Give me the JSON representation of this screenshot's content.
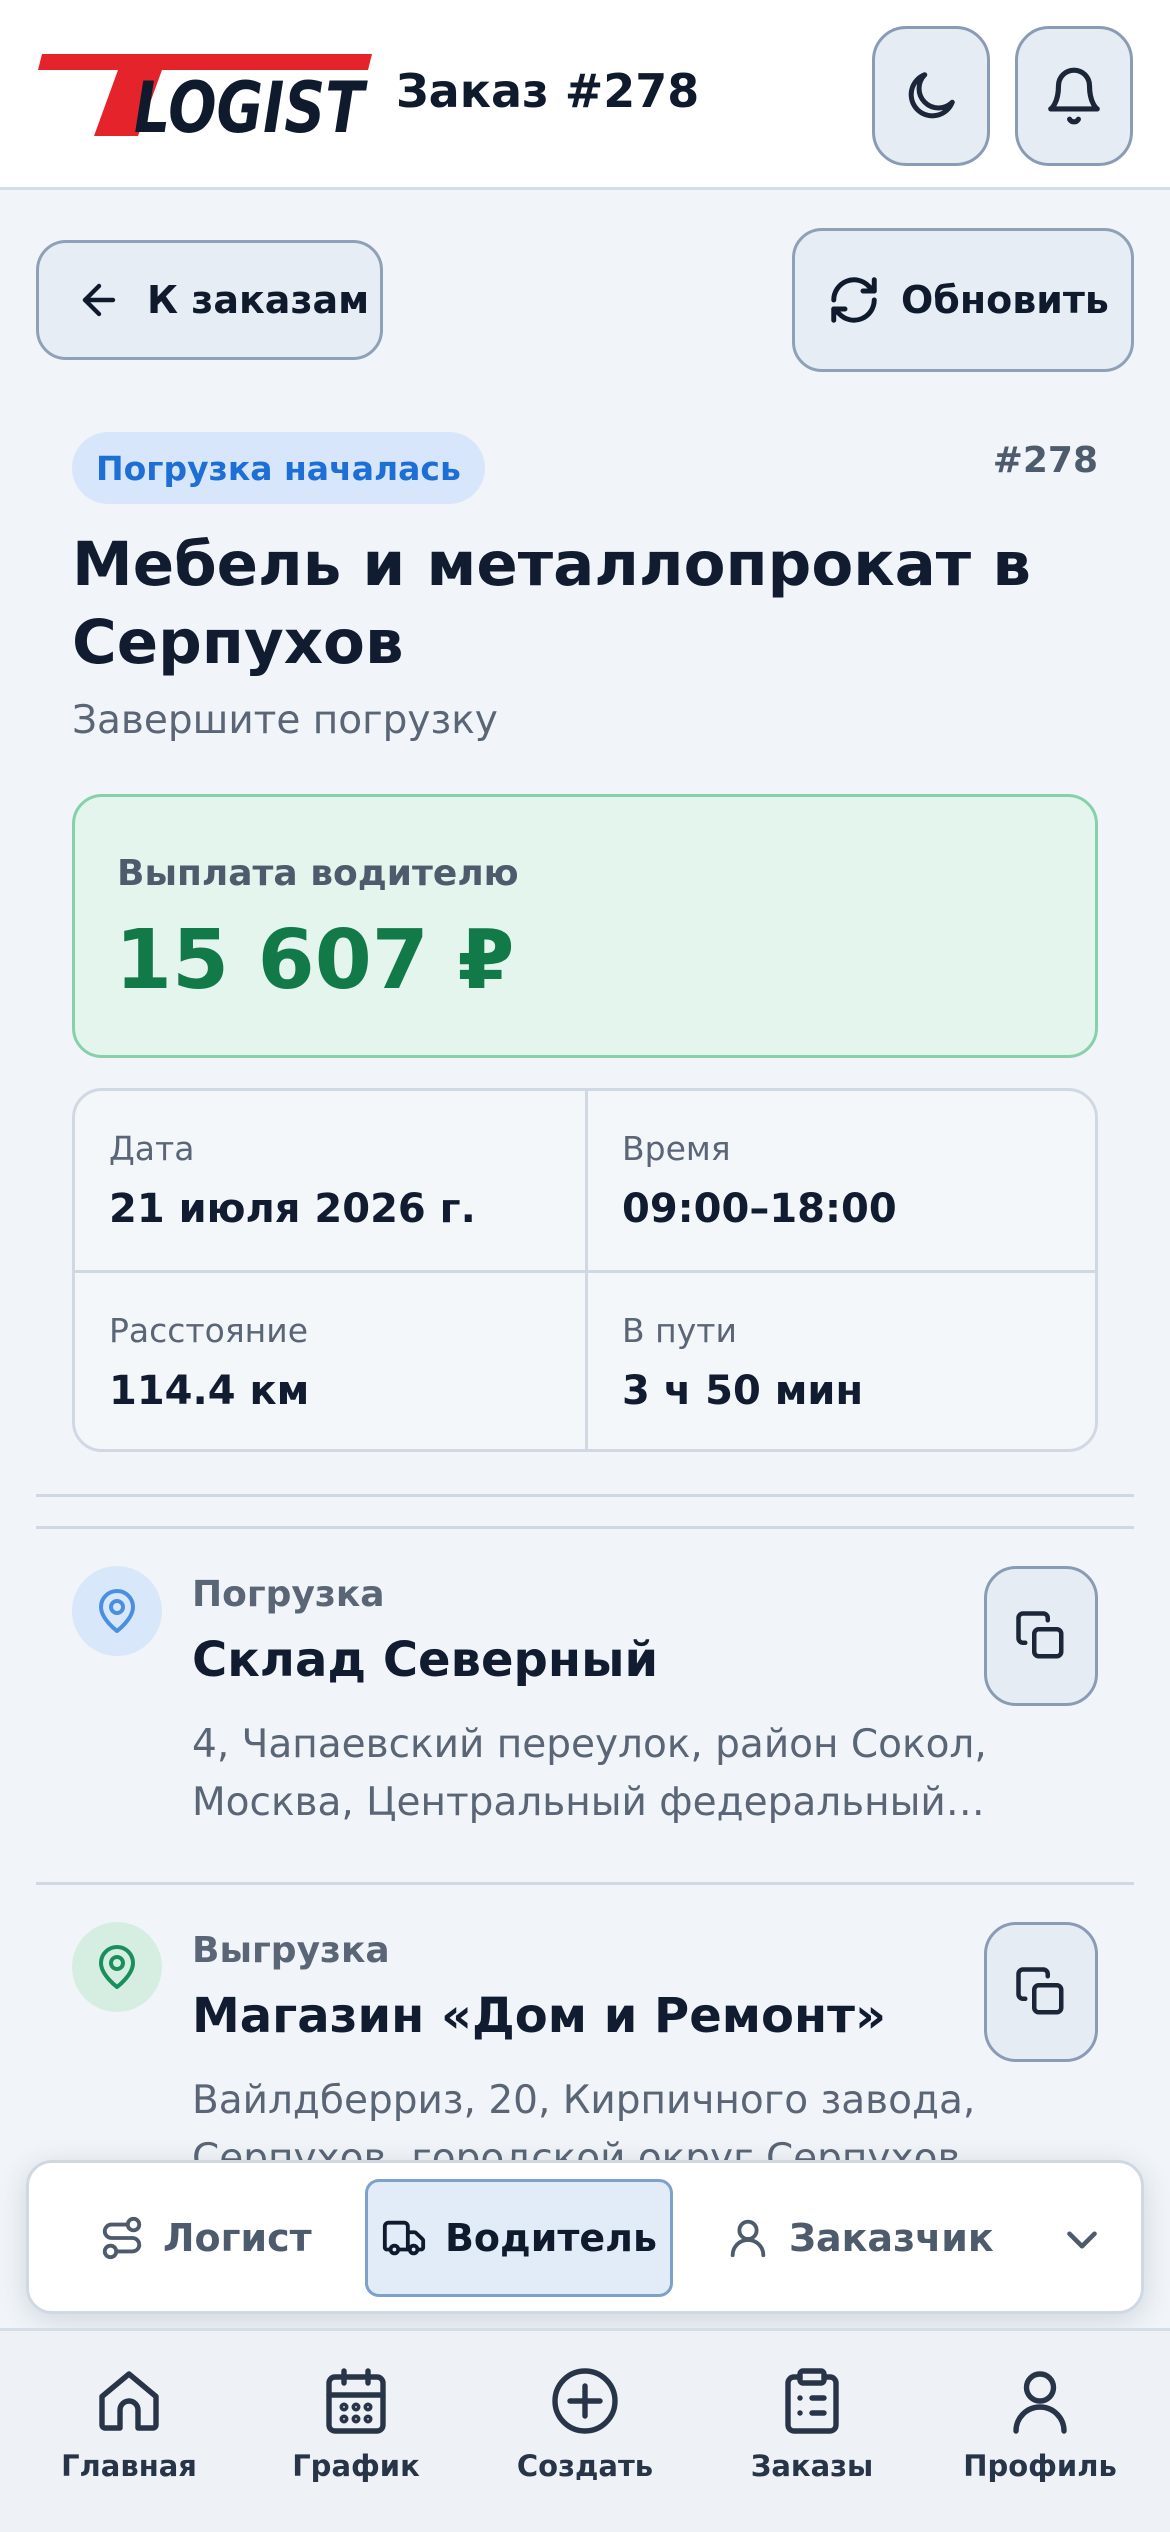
{
  "header": {
    "logo_text": "TLOGIST",
    "title": "Заказ #278",
    "theme_icon": "moon-icon",
    "notifications_icon": "bell-icon"
  },
  "toolbar": {
    "back_label": "К заказам",
    "refresh_label": "Обновить"
  },
  "order": {
    "status": "Погрузка началась",
    "number": "#278",
    "title": "Мебель и металлопрокат в Серпухов",
    "subtitle": "Завершите погрузку"
  },
  "payout": {
    "label": "Выплата водителю",
    "value": "15 607 ₽"
  },
  "info": {
    "date_label": "Дата",
    "date_value": "21 июля 2026 г.",
    "time_label": "Время",
    "time_value": "09:00–18:00",
    "distance_label": "Расстояние",
    "distance_value": "114.4 км",
    "duration_label": "В пути",
    "duration_value": "3 ч 50 мин"
  },
  "stops": [
    {
      "type": "Погрузка",
      "name": "Склад Северный",
      "address": "4, Чапаевский переулок, район Сокол, Москва, Центральный федеральный…",
      "icon": "map-pin-icon",
      "color": "#4a90e2"
    },
    {
      "type": "Выгрузка",
      "name": "Магазин «Дом и Ремонт»",
      "address": "Вайлдберриз, 20, Кирпичного завода, Серпухов, городской округ Серпухов",
      "icon": "map-pin-icon",
      "color": "#1a8f5c"
    }
  ],
  "roles": {
    "logist": "Логист",
    "driver": "Водитель",
    "client": "Заказчик",
    "active": "Водитель"
  },
  "nav": {
    "home": "Главная",
    "schedule": "График",
    "create": "Создать",
    "orders": "Заказы",
    "profile": "Профиль"
  },
  "colors": {
    "accent": "#1d6fd6",
    "payout": "#127a48",
    "logo_red": "#e5232b"
  }
}
